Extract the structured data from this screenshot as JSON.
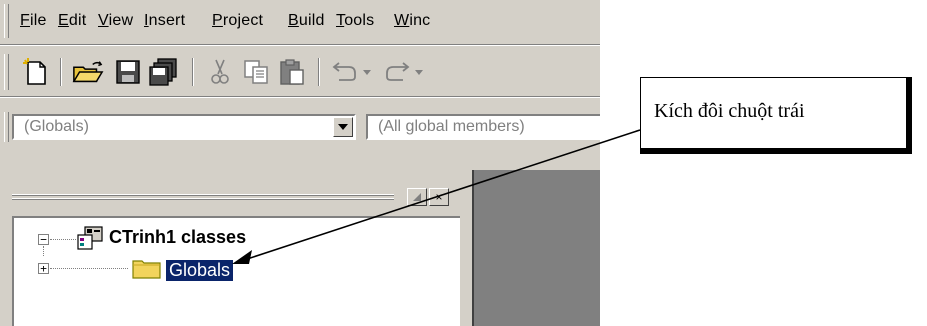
{
  "menubar": {
    "items": [
      {
        "pre": "",
        "ul": "F",
        "post": "ile"
      },
      {
        "pre": "",
        "ul": "E",
        "post": "dit"
      },
      {
        "pre": "",
        "ul": "V",
        "post": "iew"
      },
      {
        "pre": "",
        "ul": "I",
        "post": "nsert"
      },
      {
        "pre": "",
        "ul": "P",
        "post": "roject"
      },
      {
        "pre": "",
        "ul": "B",
        "post": "uild"
      },
      {
        "pre": "",
        "ul": "T",
        "post": "ools"
      },
      {
        "pre": "",
        "ul": "W",
        "post": "inc"
      }
    ]
  },
  "toolbar": {
    "buttons": [
      "new-file-icon",
      "open-folder-icon",
      "save-icon",
      "save-all-icon",
      "cut-icon",
      "copy-icon",
      "paste-icon",
      "undo-icon",
      "redo-icon"
    ]
  },
  "wizardbar": {
    "scope_combo": "(Globals)",
    "members_combo": "(All global members)"
  },
  "workspace": {
    "close_glyph": "×",
    "tree": {
      "root_label": "CTrinh1 classes",
      "root_expander": "−",
      "child_label": "Globals",
      "child_expander": "+"
    }
  },
  "callout": {
    "text": "Kích đôi chuột trái"
  },
  "colors": {
    "face": "#d4d0c8",
    "selection": "#0a246a",
    "editor": "#808080"
  }
}
